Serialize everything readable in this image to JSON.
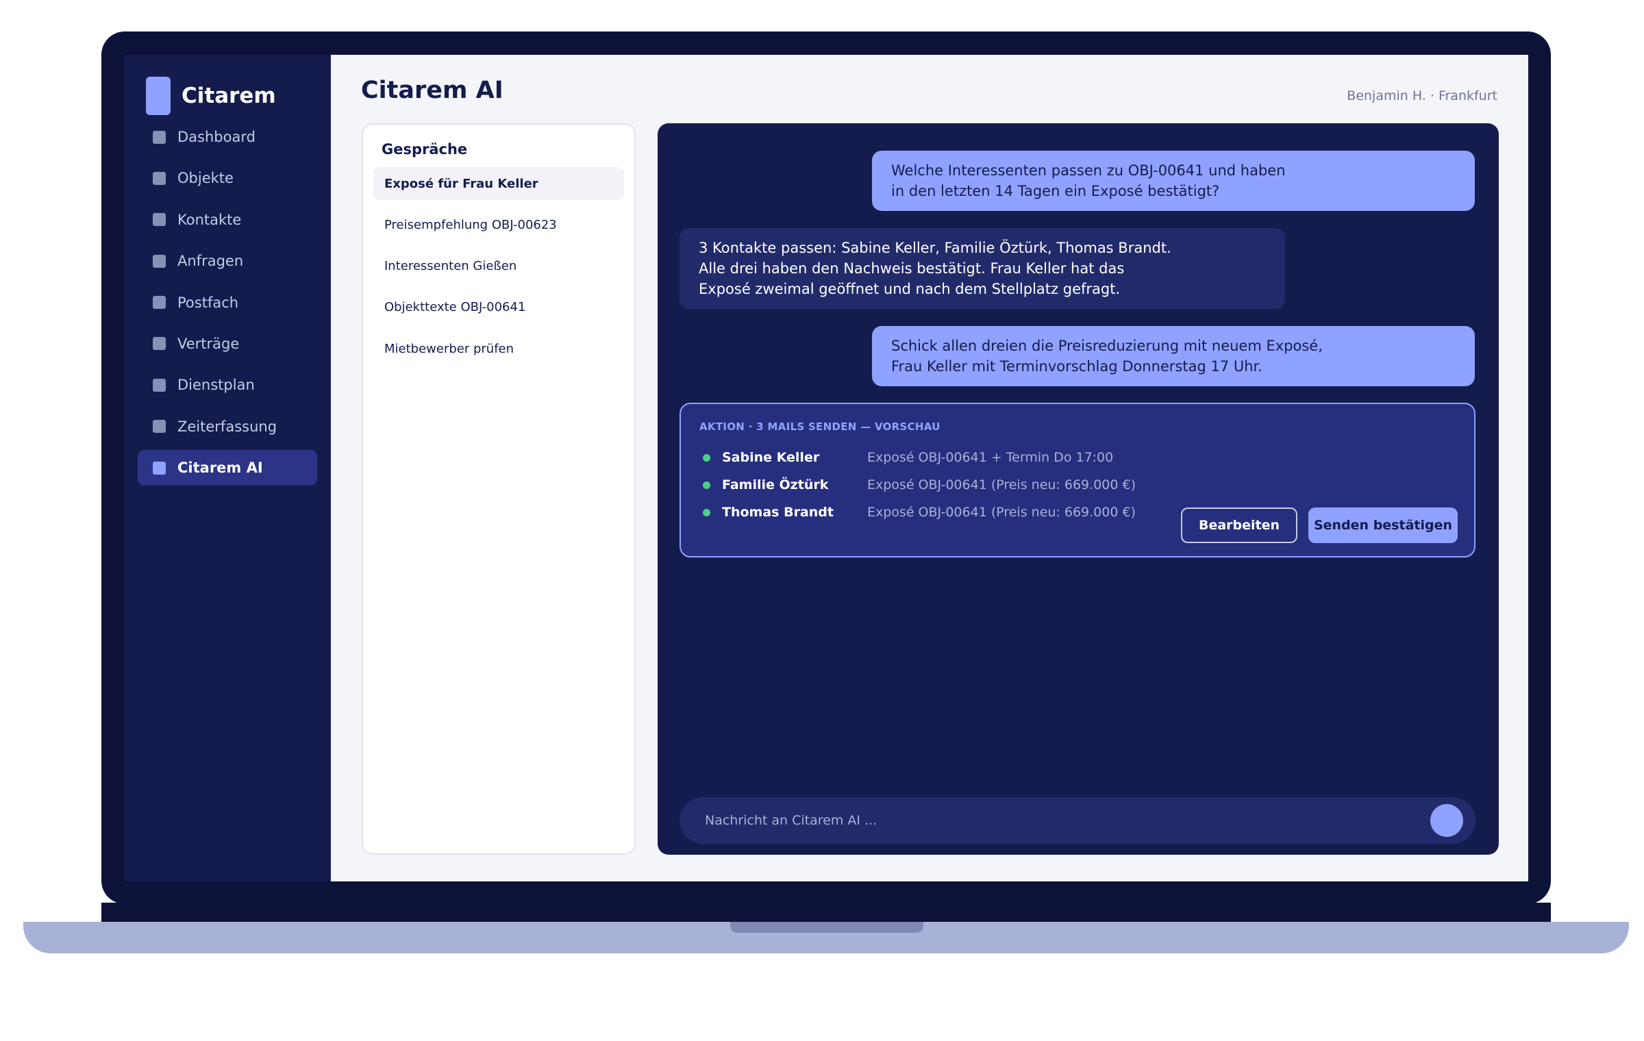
{
  "brand": {
    "name": "Citarem"
  },
  "sidebar": {
    "items": [
      {
        "label": "Dashboard"
      },
      {
        "label": "Objekte"
      },
      {
        "label": "Kontakte"
      },
      {
        "label": "Anfragen"
      },
      {
        "label": "Postfach"
      },
      {
        "label": "Verträge"
      },
      {
        "label": "Dienstplan"
      },
      {
        "label": "Zeiterfassung"
      },
      {
        "label": "Citarem AI",
        "active": true
      }
    ]
  },
  "header": {
    "title": "Citarem AI",
    "user": "Benjamin H. · Frankfurt"
  },
  "conversations": {
    "title": "Gespräche",
    "items": [
      {
        "label": "Exposé für Frau Keller",
        "active": true
      },
      {
        "label": "Preisempfehlung OBJ-00623"
      },
      {
        "label": "Interessenten Gießen"
      },
      {
        "label": "Objekttexte OBJ-00641"
      },
      {
        "label": "Mietbewerber prüfen"
      }
    ]
  },
  "chat": {
    "messages": [
      {
        "role": "user",
        "lines": [
          "Welche Interessenten passen zu OBJ-00641 und haben",
          "in den letzten 14 Tagen ein Exposé bestätigt?"
        ]
      },
      {
        "role": "assistant",
        "lines": [
          "3 Kontakte passen: Sabine Keller, Familie Öztürk, Thomas Brandt.",
          "Alle drei haben den Nachweis bestätigt. Frau Keller hat das",
          "Exposé zweimal geöffnet und nach dem Stellplatz gefragt."
        ]
      },
      {
        "role": "user",
        "lines": [
          "Schick allen dreien die Preisreduzierung mit neuem Exposé,",
          "Frau Keller mit Terminvorschlag Donnerstag 17 Uhr."
        ]
      }
    ],
    "action": {
      "heading": "AKTION · 3 MAILS SENDEN — VORSCHAU",
      "recipients": [
        {
          "name": "Sabine Keller",
          "detail": "Exposé OBJ-00641 + Termin Do 17:00"
        },
        {
          "name": "Familie Öztürk",
          "detail": "Exposé OBJ-00641 (Preis neu: 669.000 €)"
        },
        {
          "name": "Thomas Brandt",
          "detail": "Exposé OBJ-00641 (Preis neu: 669.000 €)"
        }
      ],
      "edit_label": "Bearbeiten",
      "confirm_label": "Senden bestätigen"
    },
    "composer": {
      "placeholder": "Nachricht an Citarem AI ..."
    }
  },
  "colors": {
    "navy": "#141c4e",
    "accent": "#8fa2ff",
    "status_ok": "#4ccf8a"
  }
}
